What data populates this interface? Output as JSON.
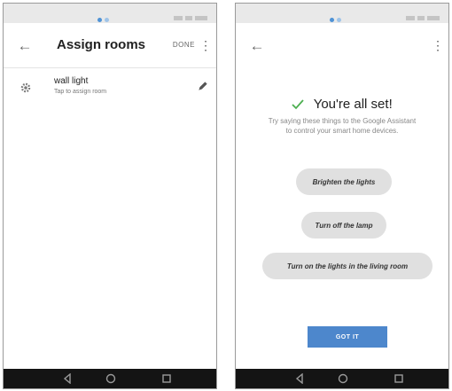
{
  "left_screen": {
    "appbar": {
      "title": "Assign rooms",
      "done_label": "DONE"
    },
    "device": {
      "name": "wall light",
      "subtitle": "Tap to assign room"
    }
  },
  "right_screen": {
    "title": "You're all set!",
    "description": "Try saying these things to the Google Assistant to control your smart home devices.",
    "suggestions": [
      "Brighten the lights",
      "Turn off the lamp",
      "Turn on the lights in the living room"
    ],
    "button_label": "GOT IT"
  },
  "colors": {
    "accent": "#4d87cc",
    "check": "#4caf50",
    "navbar": "#141414",
    "chip": "#e0e0e0",
    "statusbar": "#e9e9e9"
  },
  "icons": {
    "back": "arrow-left-icon",
    "more": "more-vertical-icon",
    "device": "settings-gear-icon",
    "edit": "pencil-icon",
    "check": "check-icon",
    "nav": [
      "nav-back-icon",
      "nav-home-icon",
      "nav-recent-icon"
    ]
  }
}
